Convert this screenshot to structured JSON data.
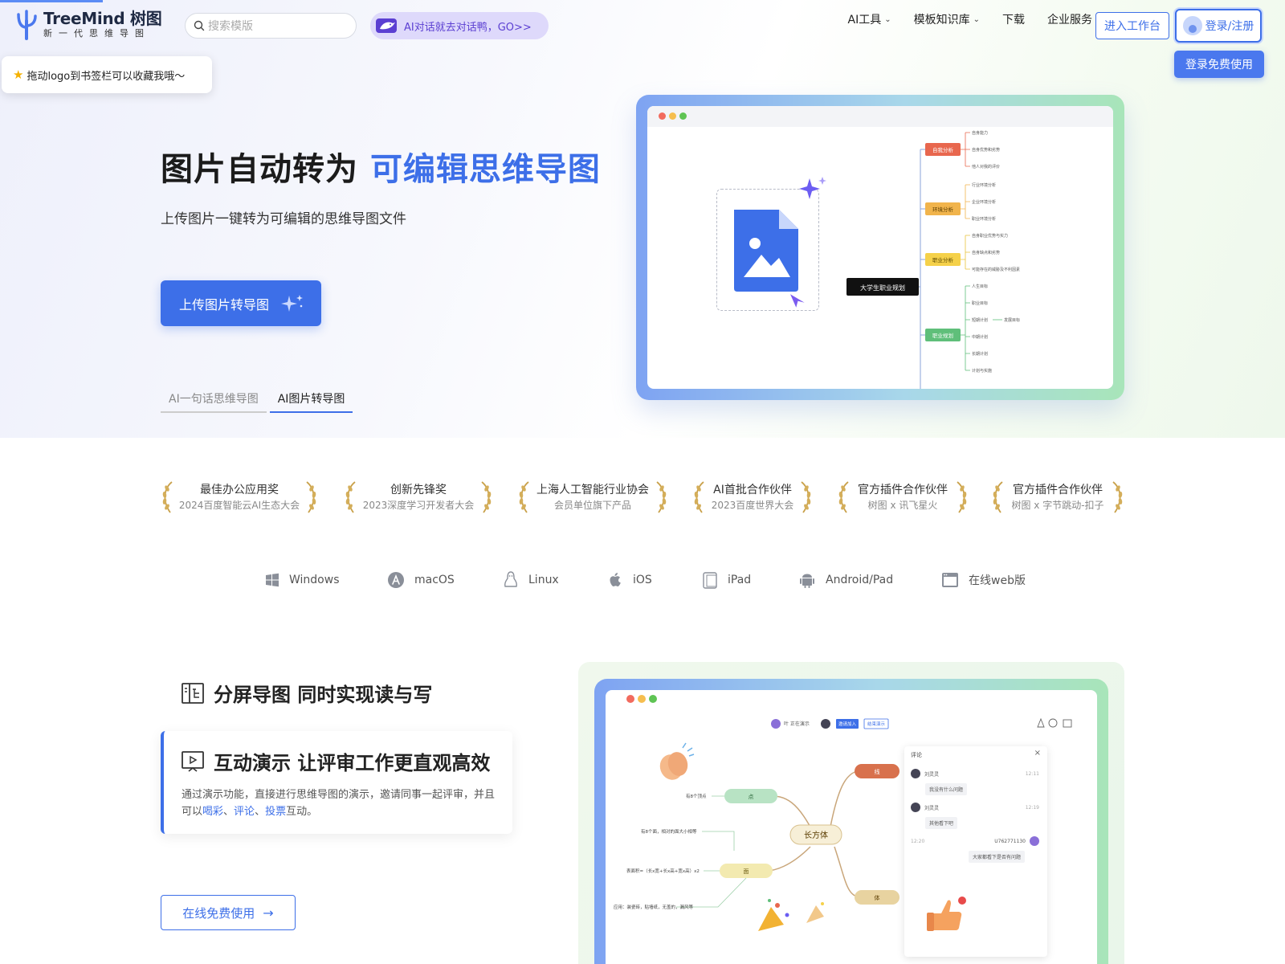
{
  "header": {
    "logo_title": "TreeMind 树图",
    "logo_sub": "新一代思维导图",
    "search_placeholder": "搜索模版",
    "ai_pill": "AI对话就去对话鸭，GO>>",
    "nav": [
      {
        "label": "AI工具",
        "dropdown": true
      },
      {
        "label": "模板知识库",
        "dropdown": true
      },
      {
        "label": "下载",
        "dropdown": false
      },
      {
        "label": "企业服务",
        "dropdown": false
      }
    ],
    "workbench_label": "进入工作台",
    "login_label": "登录/注册",
    "free_label": "登录免费使用"
  },
  "tooltip": "拖动logo到书签栏可以收藏我哦～",
  "hero": {
    "title_plain": "图片自动转为 ",
    "title_highlight": "可编辑思维导图",
    "subtitle": "上传图片一键转为可编辑的思维导图文件",
    "upload_button": "上传图片转导图",
    "tabs": [
      {
        "label": "AI一句话思维导图",
        "active": false
      },
      {
        "label": "AI图片转导图",
        "active": true
      }
    ]
  },
  "mindmap": {
    "root": "大学生职业规划",
    "branches": [
      {
        "label": "自我分析",
        "color": "#e8674e",
        "leaves": [
          "自身能力",
          "自身优势和劣势",
          "他人对我的评价"
        ]
      },
      {
        "label": "环境分析",
        "color": "#f1b44c",
        "leaves": [
          "行业环境分析",
          "企业环境分析",
          "职业环境分析"
        ]
      },
      {
        "label": "职业分析",
        "color": "#f5d14a",
        "leaves": [
          "自身职业优势与实力",
          "自身缺点和劣势",
          "可能存在的威胁及不利因素"
        ]
      },
      {
        "label": "职业规划",
        "color": "#5fbf7a",
        "leaves": [
          "人生目标",
          "职业目标",
          "短期计划",
          "中期计划",
          "长期计划",
          "计划与实施"
        ],
        "extra": "发展目标"
      }
    ]
  },
  "awards": [
    {
      "title": "最佳办公应用奖",
      "sub": "2024百度智能云AI生态大会"
    },
    {
      "title": "创新先锋奖",
      "sub": "2023深度学习开发者大会"
    },
    {
      "title": "上海人工智能行业协会",
      "sub": "会员单位旗下产品"
    },
    {
      "title": "AI首批合作伙伴",
      "sub": "2023百度世界大会"
    },
    {
      "title": "官方插件合作伙伴",
      "sub": "树图 x 讯飞星火"
    },
    {
      "title": "官方插件合作伙伴",
      "sub": "树图 x 字节跳动-扣子"
    }
  ],
  "platforms": [
    {
      "label": "Windows",
      "icon": "windows-icon"
    },
    {
      "label": "macOS",
      "icon": "macos-icon"
    },
    {
      "label": "Linux",
      "icon": "linux-icon"
    },
    {
      "label": "iOS",
      "icon": "apple-icon"
    },
    {
      "label": "iPad",
      "icon": "ipad-icon"
    },
    {
      "label": "Android/Pad",
      "icon": "android-icon"
    },
    {
      "label": "在线web版",
      "icon": "browser-icon"
    }
  ],
  "features": {
    "split_title": "分屏导图 同时实现读与写",
    "card_title": "互动演示 让评审工作更直观高效",
    "card_desc_1": "通过演示功能，直接进行思维导图的演示，邀请同事一起评审，并且可以",
    "card_links": [
      "喝彩",
      "评论",
      "投票"
    ],
    "card_desc_sep": "、",
    "card_desc_2": "互动。",
    "online_button": "在线免费使用"
  },
  "demo": {
    "presenting": "叶 正在演示",
    "invite": "邀请加入",
    "end": "结束演示",
    "center": "长方体",
    "nodes": [
      "点",
      "线",
      "面",
      "体"
    ],
    "notes": [
      "有8个顶点",
      "有8个面，相对的面大小相等",
      "表面积=（长x宽+长x高+宽x高）x2",
      "应用：装瓷砖，贴墙纸，无盖的，漏风等"
    ],
    "comment_title": "评论",
    "comments": [
      {
        "user": "刘灵灵",
        "time": "12:11",
        "text": "我没有什么问题"
      },
      {
        "user": "刘灵灵",
        "time": "12:19",
        "text": "其他看下吧"
      },
      {
        "user": "U762771130",
        "time": "12:20",
        "text": "大家都看下是否有问题"
      }
    ]
  },
  "colors": {
    "accent": "#3d6fe8",
    "ai_purple": "#5b3fd2"
  }
}
